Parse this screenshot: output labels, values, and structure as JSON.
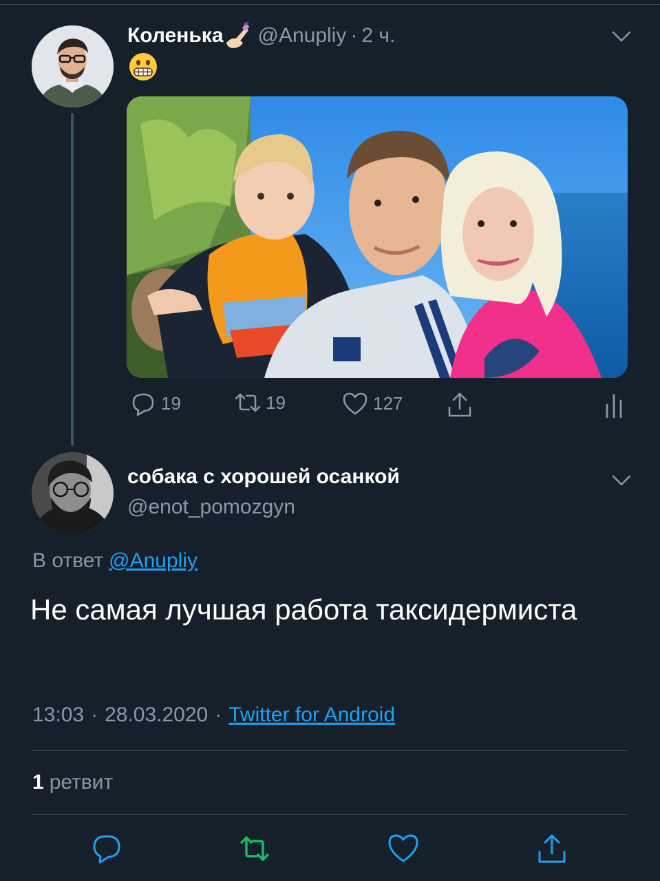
{
  "colors": {
    "background": "#15202b",
    "secondary_text": "#8899a6",
    "link": "#1da1f2",
    "retweet_green": "#17bf63",
    "divider": "#38444d"
  },
  "original_tweet": {
    "display_name": "Коленька",
    "name_emoji": "nail-polish-icon",
    "handle": "@Anupliy",
    "separator": "·",
    "time_ago": "2 ч.",
    "text_emoji": "grimacing-face-icon",
    "actions": {
      "reply_count": "19",
      "retweet_count": "19",
      "like_count": "127"
    }
  },
  "reply_tweet": {
    "display_name": "собака с хорошей осанкой",
    "handle": "@enot_pomozgyn",
    "replying_label": "В ответ",
    "replying_to": "@Anupliy",
    "text": "Не самая лучшая работа таксидермиста",
    "time": "13:03",
    "date": "28.03.2020",
    "separator": "·",
    "source": "Twitter for Android",
    "retweet_count": "1",
    "retweet_label": "ретвит"
  }
}
